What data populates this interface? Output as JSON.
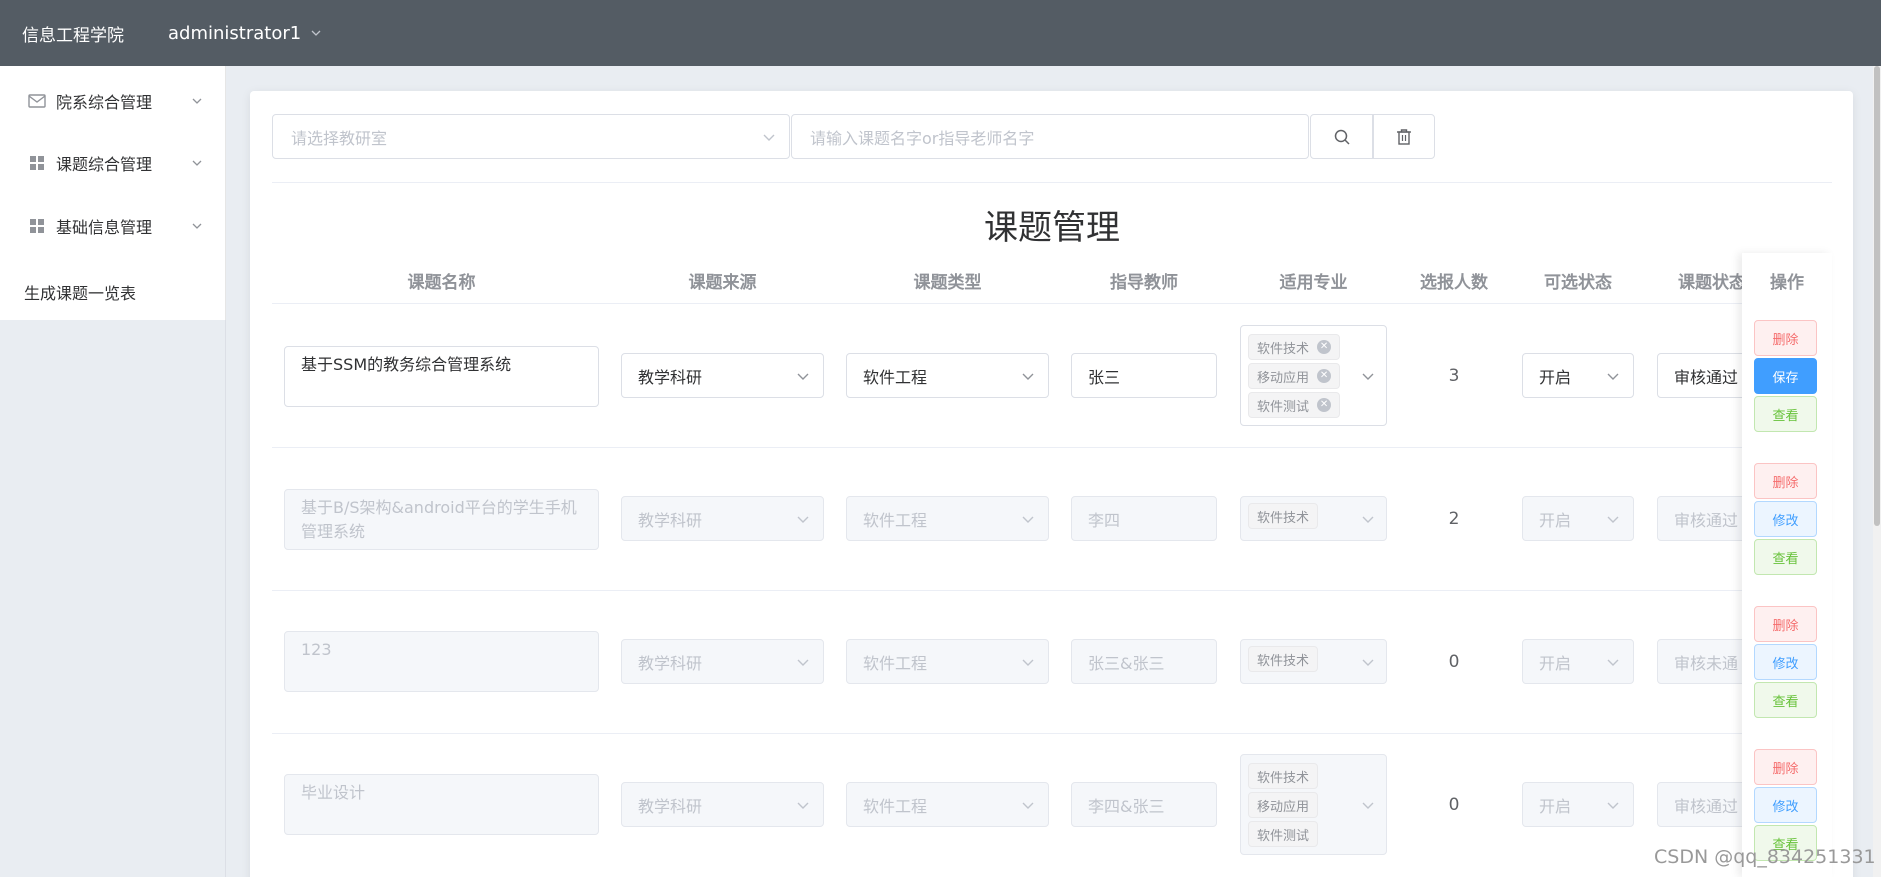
{
  "header": {
    "brand": "信息工程学院",
    "user": "administrator1"
  },
  "sidebar": {
    "items": [
      {
        "label": "院系综合管理",
        "icon": "mail-icon"
      },
      {
        "label": "课题综合管理",
        "icon": "grid-icon"
      },
      {
        "label": "基础信息管理",
        "icon": "grid-icon"
      }
    ],
    "plain_item": "生成课题一览表"
  },
  "filters": {
    "lab_placeholder": "请选择教研室",
    "search_placeholder": "请输入课题名字or指导老师名字"
  },
  "page_title": "课题管理",
  "table": {
    "headers": {
      "name": "课题名称",
      "source": "课题来源",
      "type": "课题类型",
      "teacher": "指导教师",
      "major": "适用专业",
      "count": "选报人数",
      "selectable": "可选状态",
      "status": "课题状态",
      "ops": "操作"
    },
    "rows": [
      {
        "name": "基于SSM的教务综合管理系统",
        "source": "教学科研",
        "type": "软件工程",
        "teacher": "张三",
        "majors": [
          "软件技术",
          "移动应用",
          "软件测试"
        ],
        "count": "3",
        "selectable": "开启",
        "status": "审核通过",
        "edit_label": "保存",
        "editing": true
      },
      {
        "name": "基于B/S架构&android平台的学生手机管理系统",
        "source": "教学科研",
        "type": "软件工程",
        "teacher": "李四",
        "majors": [
          "软件技术"
        ],
        "count": "2",
        "selectable": "开启",
        "status": "审核通过",
        "edit_label": "修改",
        "editing": false
      },
      {
        "name": "123",
        "source": "教学科研",
        "type": "软件工程",
        "teacher": "张三&张三",
        "majors": [
          "软件技术"
        ],
        "count": "0",
        "selectable": "开启",
        "status": "审核未通",
        "edit_label": "修改",
        "editing": false
      },
      {
        "name": "毕业设计",
        "source": "教学科研",
        "type": "软件工程",
        "teacher": "李四&张三",
        "majors": [
          "软件技术",
          "移动应用",
          "软件测试"
        ],
        "count": "0",
        "selectable": "开启",
        "status": "审核通过",
        "edit_label": "修改",
        "editing": false
      }
    ],
    "delete_label": "删除",
    "view_label": "查看"
  },
  "watermark": "CSDN @qq_834251331",
  "colors": {
    "header_bg": "#545c64",
    "primary": "#409eff",
    "danger": "#f56c6c",
    "success": "#67c23a"
  }
}
